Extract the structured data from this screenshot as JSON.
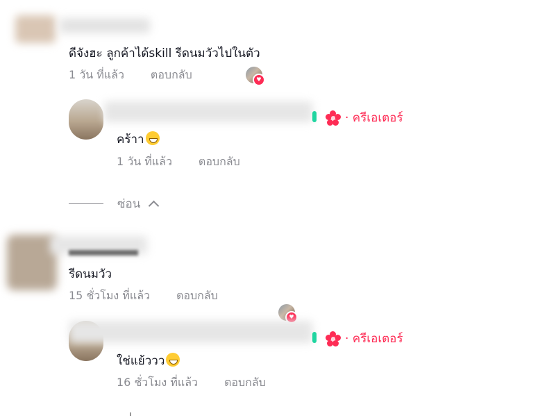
{
  "comments": [
    {
      "text": "ดีจังฮะ ลูกค้าได้skill รีดนมวัวไปในตัว",
      "time": "1 วัน ที่แล้ว",
      "reply": "ตอบกลับ"
    },
    {
      "text": "รีดนมวัว",
      "time": "15 ชั่วโมง ที่แล้ว",
      "reply": "ตอบกลับ"
    }
  ],
  "replies": [
    {
      "badge": "· ครีเอเตอร์",
      "text": "คร้าา",
      "time": "1 วัน ที่แล้ว",
      "reply": "ตอบกลับ"
    },
    {
      "badge": "· ครีเอเตอร์",
      "text": "ใช่แย้ววว",
      "time": "16 ชั่วโมง ที่แล้ว",
      "reply": "ตอบกลับ"
    }
  ],
  "hide_label": "ซ่อน",
  "colors": {
    "accent": "#fe2c55",
    "secondary_text": "#8a8b91"
  }
}
